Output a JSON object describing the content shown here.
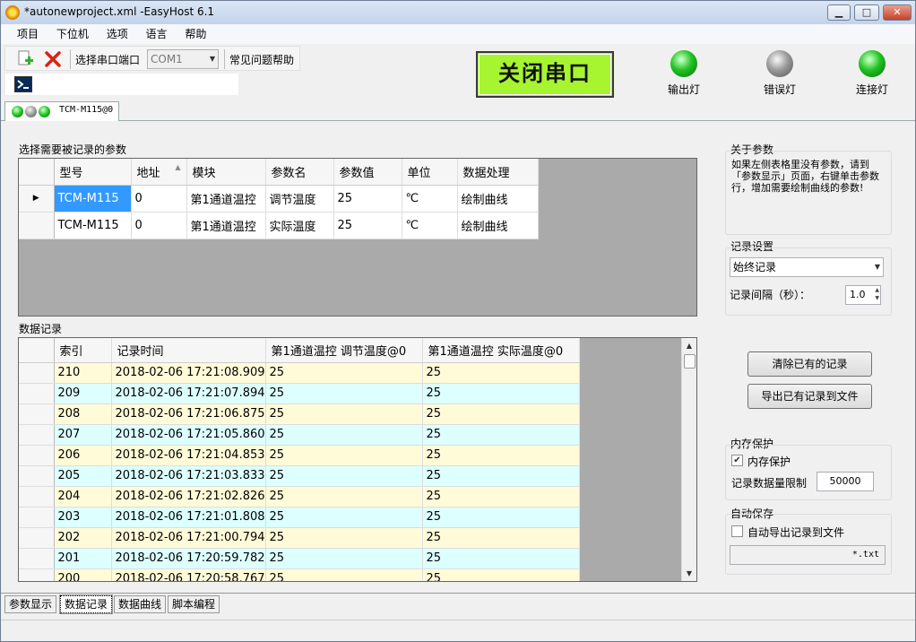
{
  "window": {
    "title": "*autonewproject.xml -EasyHost 6.1",
    "min_label": "▁",
    "max_label": "□",
    "close_label": "✕"
  },
  "menu": [
    "项目",
    "下位机",
    "选项",
    "语言",
    "帮助"
  ],
  "toolbar": {
    "port_label": "选择串口端口",
    "port_value": "COM1",
    "help_label": "常见问题帮助"
  },
  "close_port_button": "关闭串口",
  "lights": [
    {
      "label": "输出灯",
      "state": "green"
    },
    {
      "label": "错误灯",
      "state": "gray"
    },
    {
      "label": "连接灯",
      "state": "green"
    }
  ],
  "device_tab": {
    "label": "TCM-M115@0"
  },
  "params": {
    "group_label": "选择需要被记录的参数",
    "columns": [
      "型号",
      "地址",
      "模块",
      "参数名",
      "参数值",
      "单位",
      "数据处理"
    ],
    "rows": [
      [
        "TCM-M115",
        "0",
        "第1通道温控",
        "调节温度",
        "25",
        "℃",
        "绘制曲线"
      ],
      [
        "TCM-M115",
        "0",
        "第1通道温控",
        "实际温度",
        "25",
        "℃",
        "绘制曲线"
      ]
    ]
  },
  "records": {
    "group_label": "数据记录",
    "columns": [
      "索引",
      "记录时间",
      "第1通道温控 调节温度@0",
      "第1通道温控 实际温度@0"
    ],
    "rows": [
      [
        "210",
        "2018-02-06 17:21:08.909",
        "25",
        "25"
      ],
      [
        "209",
        "2018-02-06 17:21:07.894",
        "25",
        "25"
      ],
      [
        "208",
        "2018-02-06 17:21:06.875",
        "25",
        "25"
      ],
      [
        "207",
        "2018-02-06 17:21:05.860",
        "25",
        "25"
      ],
      [
        "206",
        "2018-02-06 17:21:04.853",
        "25",
        "25"
      ],
      [
        "205",
        "2018-02-06 17:21:03.833",
        "25",
        "25"
      ],
      [
        "204",
        "2018-02-06 17:21:02.826",
        "25",
        "25"
      ],
      [
        "203",
        "2018-02-06 17:21:01.808",
        "25",
        "25"
      ],
      [
        "202",
        "2018-02-06 17:21:00.794",
        "25",
        "25"
      ],
      [
        "201",
        "2018-02-06 17:20:59.782",
        "25",
        "25"
      ],
      [
        "200",
        "2018-02-06 17:20:58.767",
        "25",
        "25"
      ]
    ]
  },
  "about": {
    "label": "关于参数",
    "text": "如果左侧表格里没有参数，请到「参数显示」页面，右键单击参数行，增加需要绘制曲线的参数!"
  },
  "record_settings": {
    "label": "记录设置",
    "mode": "始终记录",
    "interval_label": "记录间隔（秒）：",
    "interval_value": "1.0"
  },
  "buttons": {
    "clear": "清除已有的记录",
    "export": "导出已有记录到文件"
  },
  "memory": {
    "label": "内存保护",
    "checkbox_label": "内存保护",
    "checked": true,
    "limit_label": "记录数据量限制",
    "limit_value": "50000"
  },
  "autosave": {
    "label": "自动保存",
    "checkbox_label": "自动导出记录到文件",
    "checked": false,
    "file_value": "*.txt"
  },
  "bottom_tabs": [
    "参数显示",
    "数据记录",
    "数据曲线",
    "脚本编程"
  ]
}
